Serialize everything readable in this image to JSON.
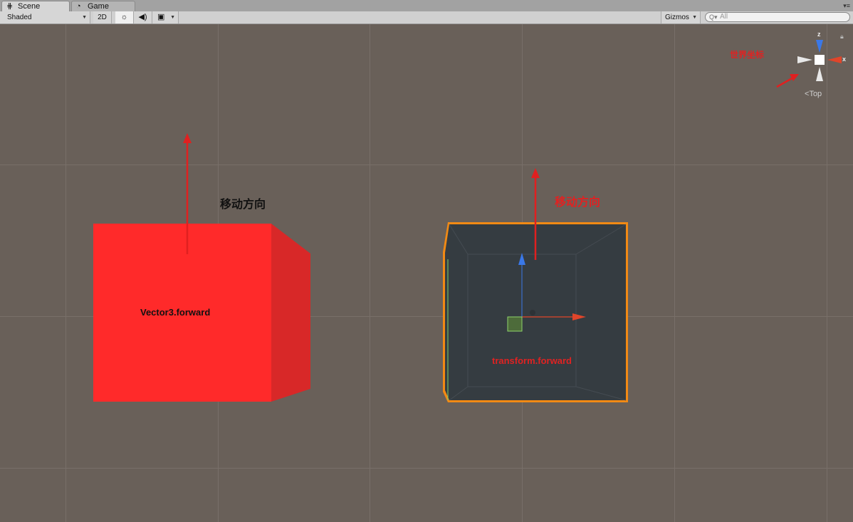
{
  "tabs": [
    {
      "label": "Scene",
      "icon": "grid-icon"
    },
    {
      "label": "Game",
      "icon": "pacman-icon"
    }
  ],
  "toolbar": {
    "shading_mode": "Shaded",
    "mode_2d": "2D",
    "gizmos_label": "Gizmos",
    "search_placeholder": "All"
  },
  "scene": {
    "left_cube_label": "Vector3.forward",
    "left_move_label": "移动方向",
    "right_cube_label": "transform.forward",
    "right_move_label": "移动方向",
    "world_coord_label": "世界坐标",
    "axis_z": "z",
    "axis_x": "x",
    "view_label": "Top"
  },
  "colors": {
    "scene_bg": "#696059",
    "cube_red": "#ff2a2a",
    "annotation_red": "#e02222",
    "selection_orange": "#f28a14",
    "axis_blue": "#3a78e8"
  }
}
